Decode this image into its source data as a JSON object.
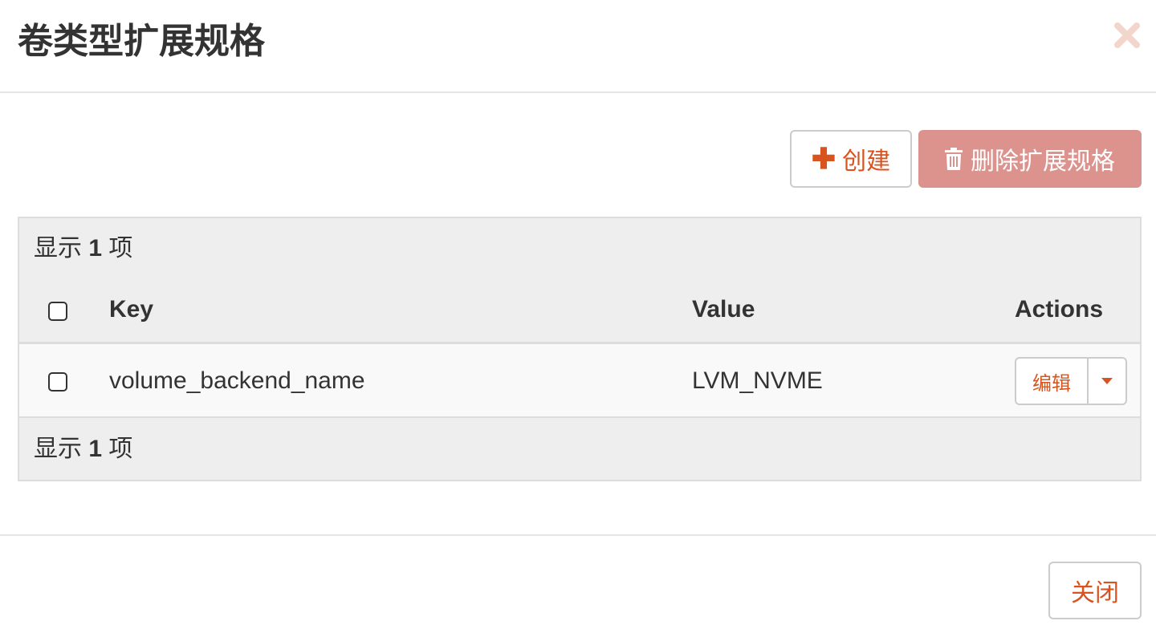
{
  "modal": {
    "title": "卷类型扩展规格"
  },
  "toolbar": {
    "create_label": "创建",
    "delete_label": "删除扩展规格"
  },
  "table": {
    "count_prefix": "显示",
    "count_number": "1",
    "count_suffix": "项",
    "columns": {
      "key": "Key",
      "value": "Value",
      "actions": "Actions"
    },
    "rows": [
      {
        "key": "volume_backend_name",
        "value": "LVM_NVME",
        "edit_label": "编辑"
      }
    ]
  },
  "footer": {
    "close_label": "关闭"
  },
  "colors": {
    "accent": "#d9531e",
    "danger_disabled": "#dc938e",
    "table_bg": "#eeeeee",
    "row_bg": "#f9f9f9"
  },
  "icons": {
    "close": "close-icon",
    "create": "plus-icon",
    "delete": "trash-icon",
    "dropdown": "caret-down-icon"
  }
}
